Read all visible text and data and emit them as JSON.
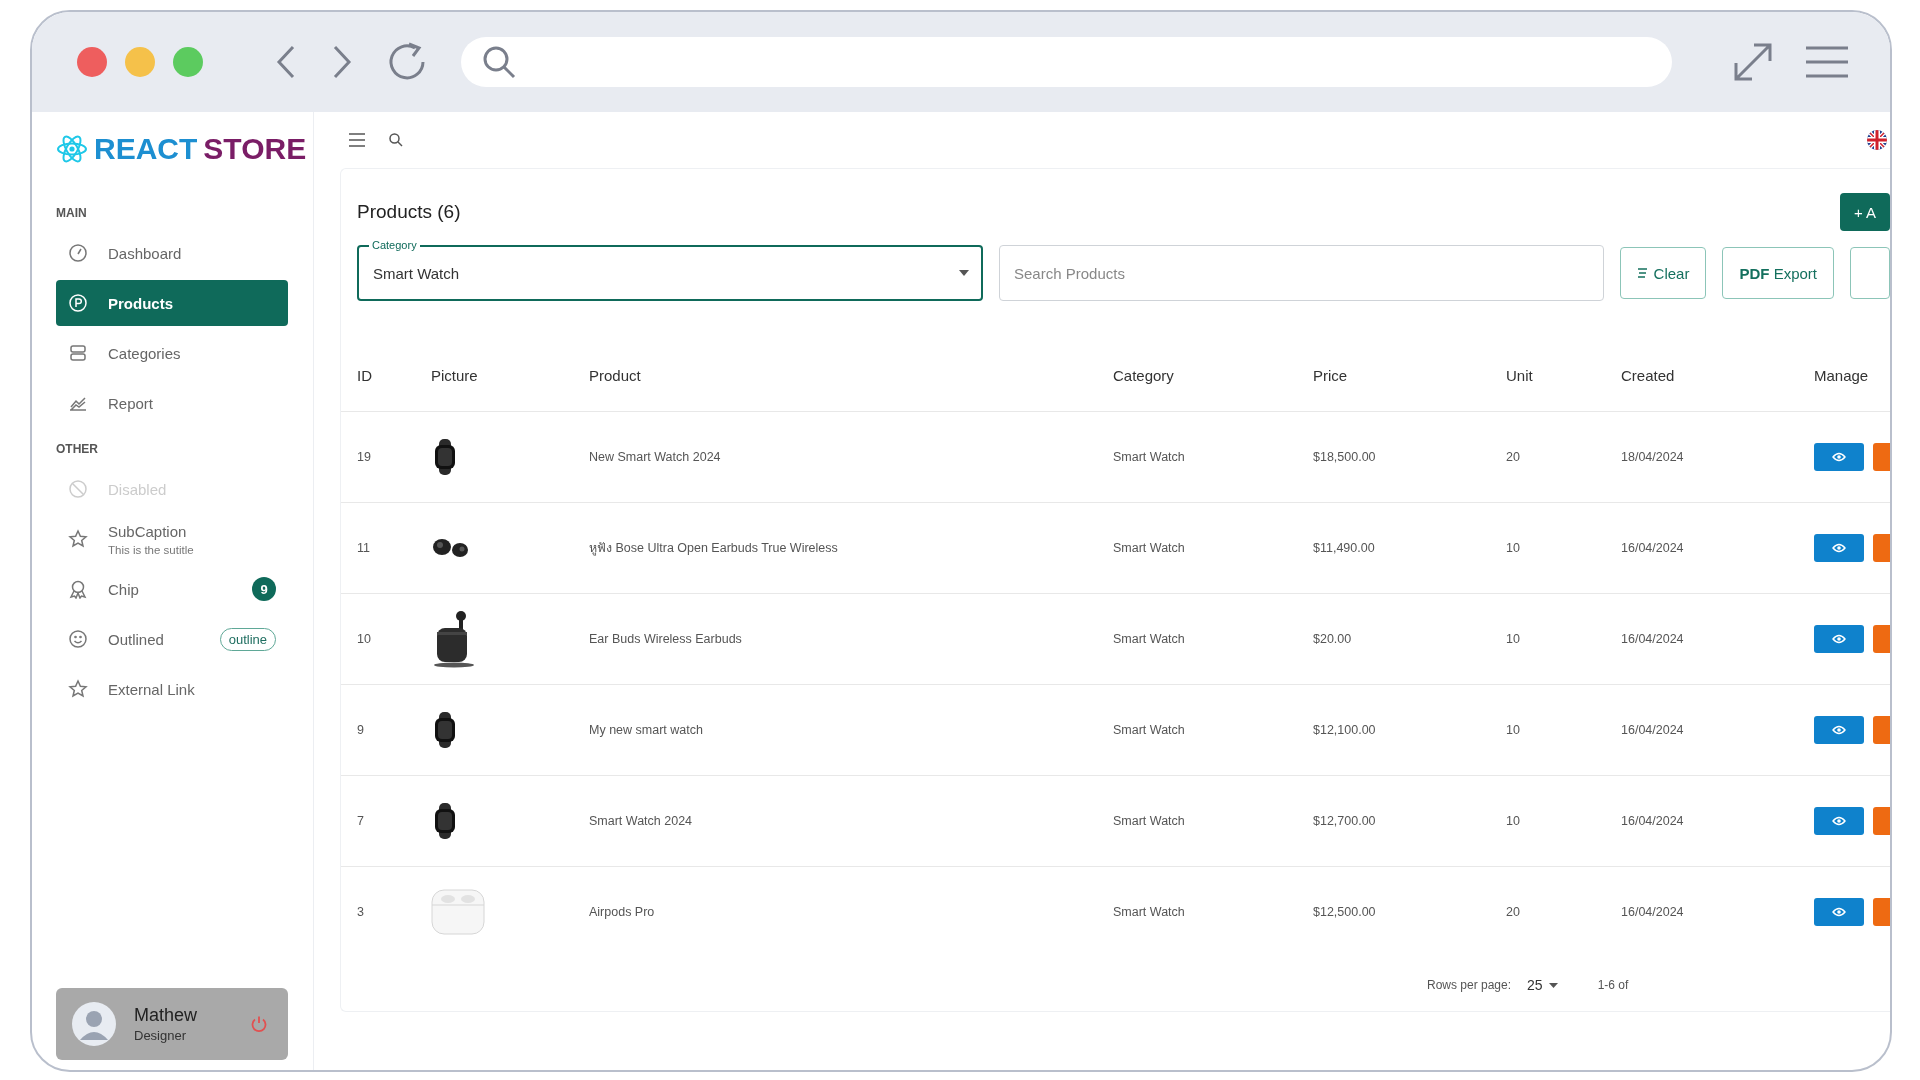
{
  "sidebar": {
    "logo": {
      "first": "REACT",
      "second": "STORE"
    },
    "sections": [
      {
        "title": "MAIN",
        "items": [
          {
            "label": "Dashboard",
            "selected": false,
            "disabled": false
          },
          {
            "label": "Products",
            "selected": true,
            "disabled": false
          },
          {
            "label": "Categories",
            "selected": false,
            "disabled": false
          },
          {
            "label": "Report",
            "selected": false,
            "disabled": false
          }
        ]
      },
      {
        "title": "OTHER",
        "items": [
          {
            "label": "Disabled",
            "selected": false,
            "disabled": true
          },
          {
            "label": "SubCaption",
            "subtitle": "This is the sutitle",
            "selected": false,
            "disabled": false
          },
          {
            "label": "Chip",
            "badge": "9",
            "selected": false,
            "disabled": false
          },
          {
            "label": "Outlined",
            "chip": "outline",
            "selected": false,
            "disabled": false
          },
          {
            "label": "External Link",
            "selected": false,
            "disabled": false
          }
        ]
      }
    ],
    "user": {
      "name": "Mathew",
      "role": "Designer"
    }
  },
  "card": {
    "title": "Products (6)",
    "add_button": "+ A",
    "category_field": {
      "label": "Category",
      "value": "Smart Watch"
    },
    "search": {
      "placeholder": "Search Products"
    },
    "buttons": [
      "Clear",
      "**PDF** Export"
    ]
  },
  "table": {
    "columns": [
      "ID",
      "Picture",
      "Product",
      "Category",
      "Price",
      "Unit",
      "Created",
      "Manage"
    ],
    "rows": [
      {
        "id": "19",
        "kind": "watch",
        "product": "New Smart Watch 2024",
        "category": "Smart Watch",
        "price": "$18,500.00",
        "unit": "20",
        "created": "18/04/2024"
      },
      {
        "id": "11",
        "kind": "earbuds",
        "product": "หูฟัง Bose Ultra Open Earbuds True Wireless",
        "category": "Smart Watch",
        "price": "$11,490.00",
        "unit": "10",
        "created": "16/04/2024"
      },
      {
        "id": "10",
        "kind": "case",
        "product": "Ear Buds Wireless Earbuds",
        "category": "Smart Watch",
        "price": "$20.00",
        "unit": "10",
        "created": "16/04/2024"
      },
      {
        "id": "9",
        "kind": "watch",
        "product": "My new smart watch",
        "category": "Smart Watch",
        "price": "$12,100.00",
        "unit": "10",
        "created": "16/04/2024"
      },
      {
        "id": "7",
        "kind": "watch",
        "product": "Smart Watch 2024",
        "category": "Smart Watch",
        "price": "$12,700.00",
        "unit": "10",
        "created": "16/04/2024"
      },
      {
        "id": "3",
        "kind": "white-case",
        "product": "Airpods Pro",
        "category": "Smart Watch",
        "price": "$12,500.00",
        "unit": "20",
        "created": "16/04/2024"
      }
    ]
  },
  "pagination": {
    "label": "Rows per page:",
    "rows_per_page": "25",
    "range": "1-6 of"
  }
}
